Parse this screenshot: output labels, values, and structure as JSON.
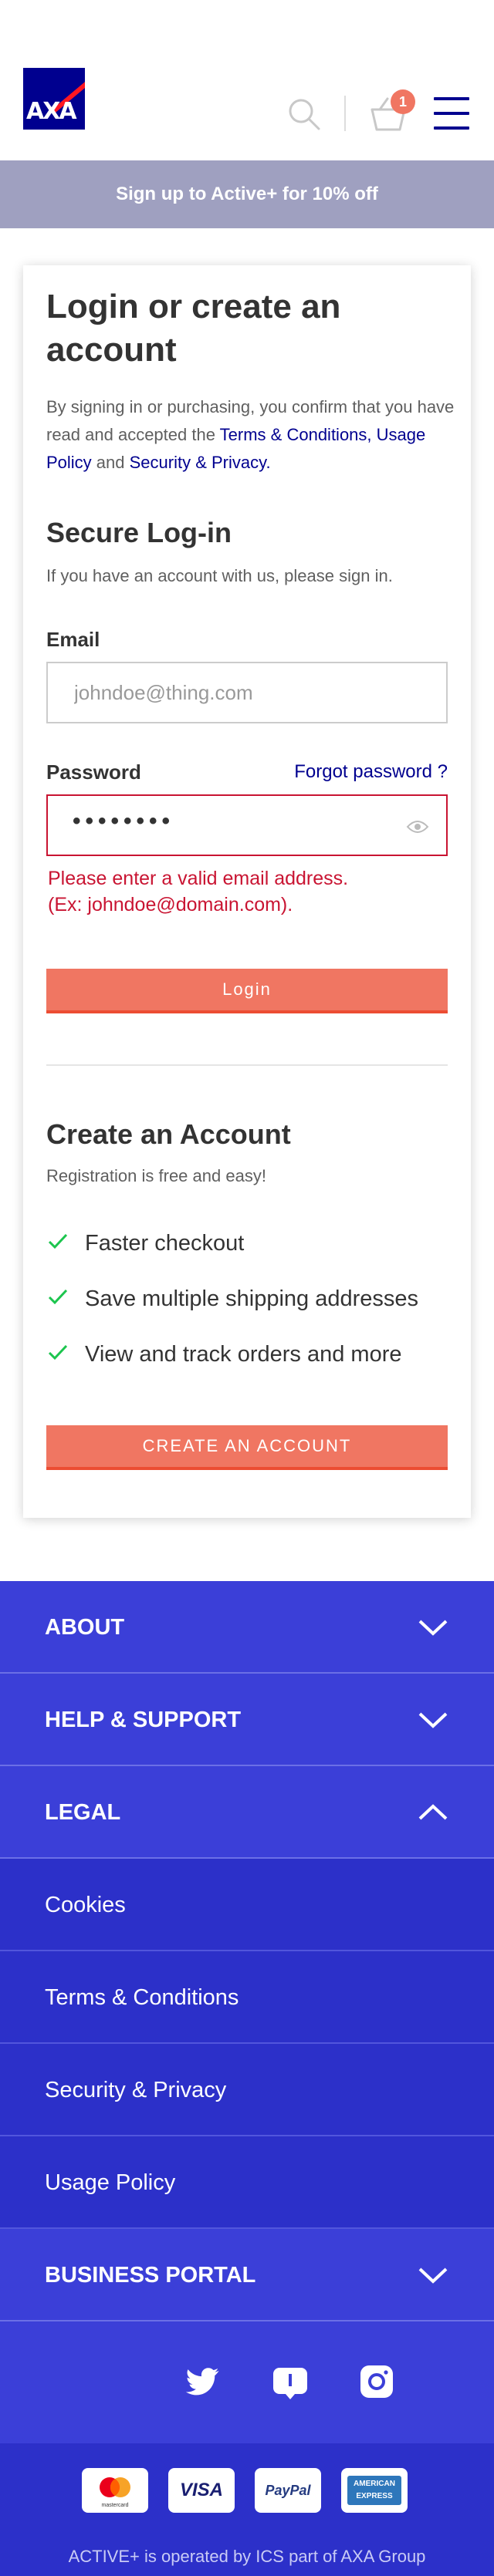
{
  "header": {
    "logo_text": "AXA",
    "cart_count": "1",
    "icons": [
      "search-icon",
      "basket-icon",
      "menu-icon"
    ],
    "brand_color": "#00008f",
    "accent_color": "#f07662"
  },
  "promo": {
    "text": "Sign up to Active+ for 10% off"
  },
  "login": {
    "title": "Login or create an account",
    "consent_prefix": "By signing in or purchasing, you confirm that you have read and accepted the ",
    "terms_link": "Terms & Conditions,",
    "usage_link": "Usage Policy",
    "consent_and": " and ",
    "security_link": "Security & Privacy.",
    "secure_title": "Secure Log-in",
    "secure_sub": "If you have an account with us, please sign in.",
    "email_label": "Email",
    "email_placeholder": "johndoe@thing.com",
    "password_label": "Password",
    "forgot_label": "Forgot password ?",
    "password_masked": "••••••••",
    "error_line1": "Please enter a valid email address.",
    "error_line2": "(Ex: johndoe@domain.com).",
    "login_button": "Login",
    "error_color": "#c91432"
  },
  "create": {
    "title": "Create an Account",
    "sub": "Registration is free and easy!",
    "benefits": [
      "Faster checkout",
      "Save multiple shipping addresses",
      "View and track orders and more"
    ],
    "button": "CREATE AN ACCOUNT"
  },
  "footer": {
    "sections": [
      {
        "label": "ABOUT",
        "expanded": false
      },
      {
        "label": "HELP & SUPPORT",
        "expanded": false
      },
      {
        "label": "LEGAL",
        "expanded": true
      },
      {
        "label": "BUSINESS PORTAL",
        "expanded": false
      }
    ],
    "legal_links": [
      "Cookies",
      "Terms & Conditions",
      "Security & Privacy",
      "Usage Policy"
    ],
    "social_icons": [
      "twitter-icon",
      "chat-icon",
      "instagram-icon"
    ],
    "payment_methods": [
      "mastercard",
      "VISA",
      "PayPal",
      "AMERICAN EXPRESS"
    ],
    "mastercard_caption": "mastercard",
    "amex_line1": "AMERICAN",
    "amex_line2": "EXPRESS",
    "fine_print": "ACTIVE+ is operated by ICS part of AXA Group",
    "footer_color": "#3b3fd8"
  }
}
